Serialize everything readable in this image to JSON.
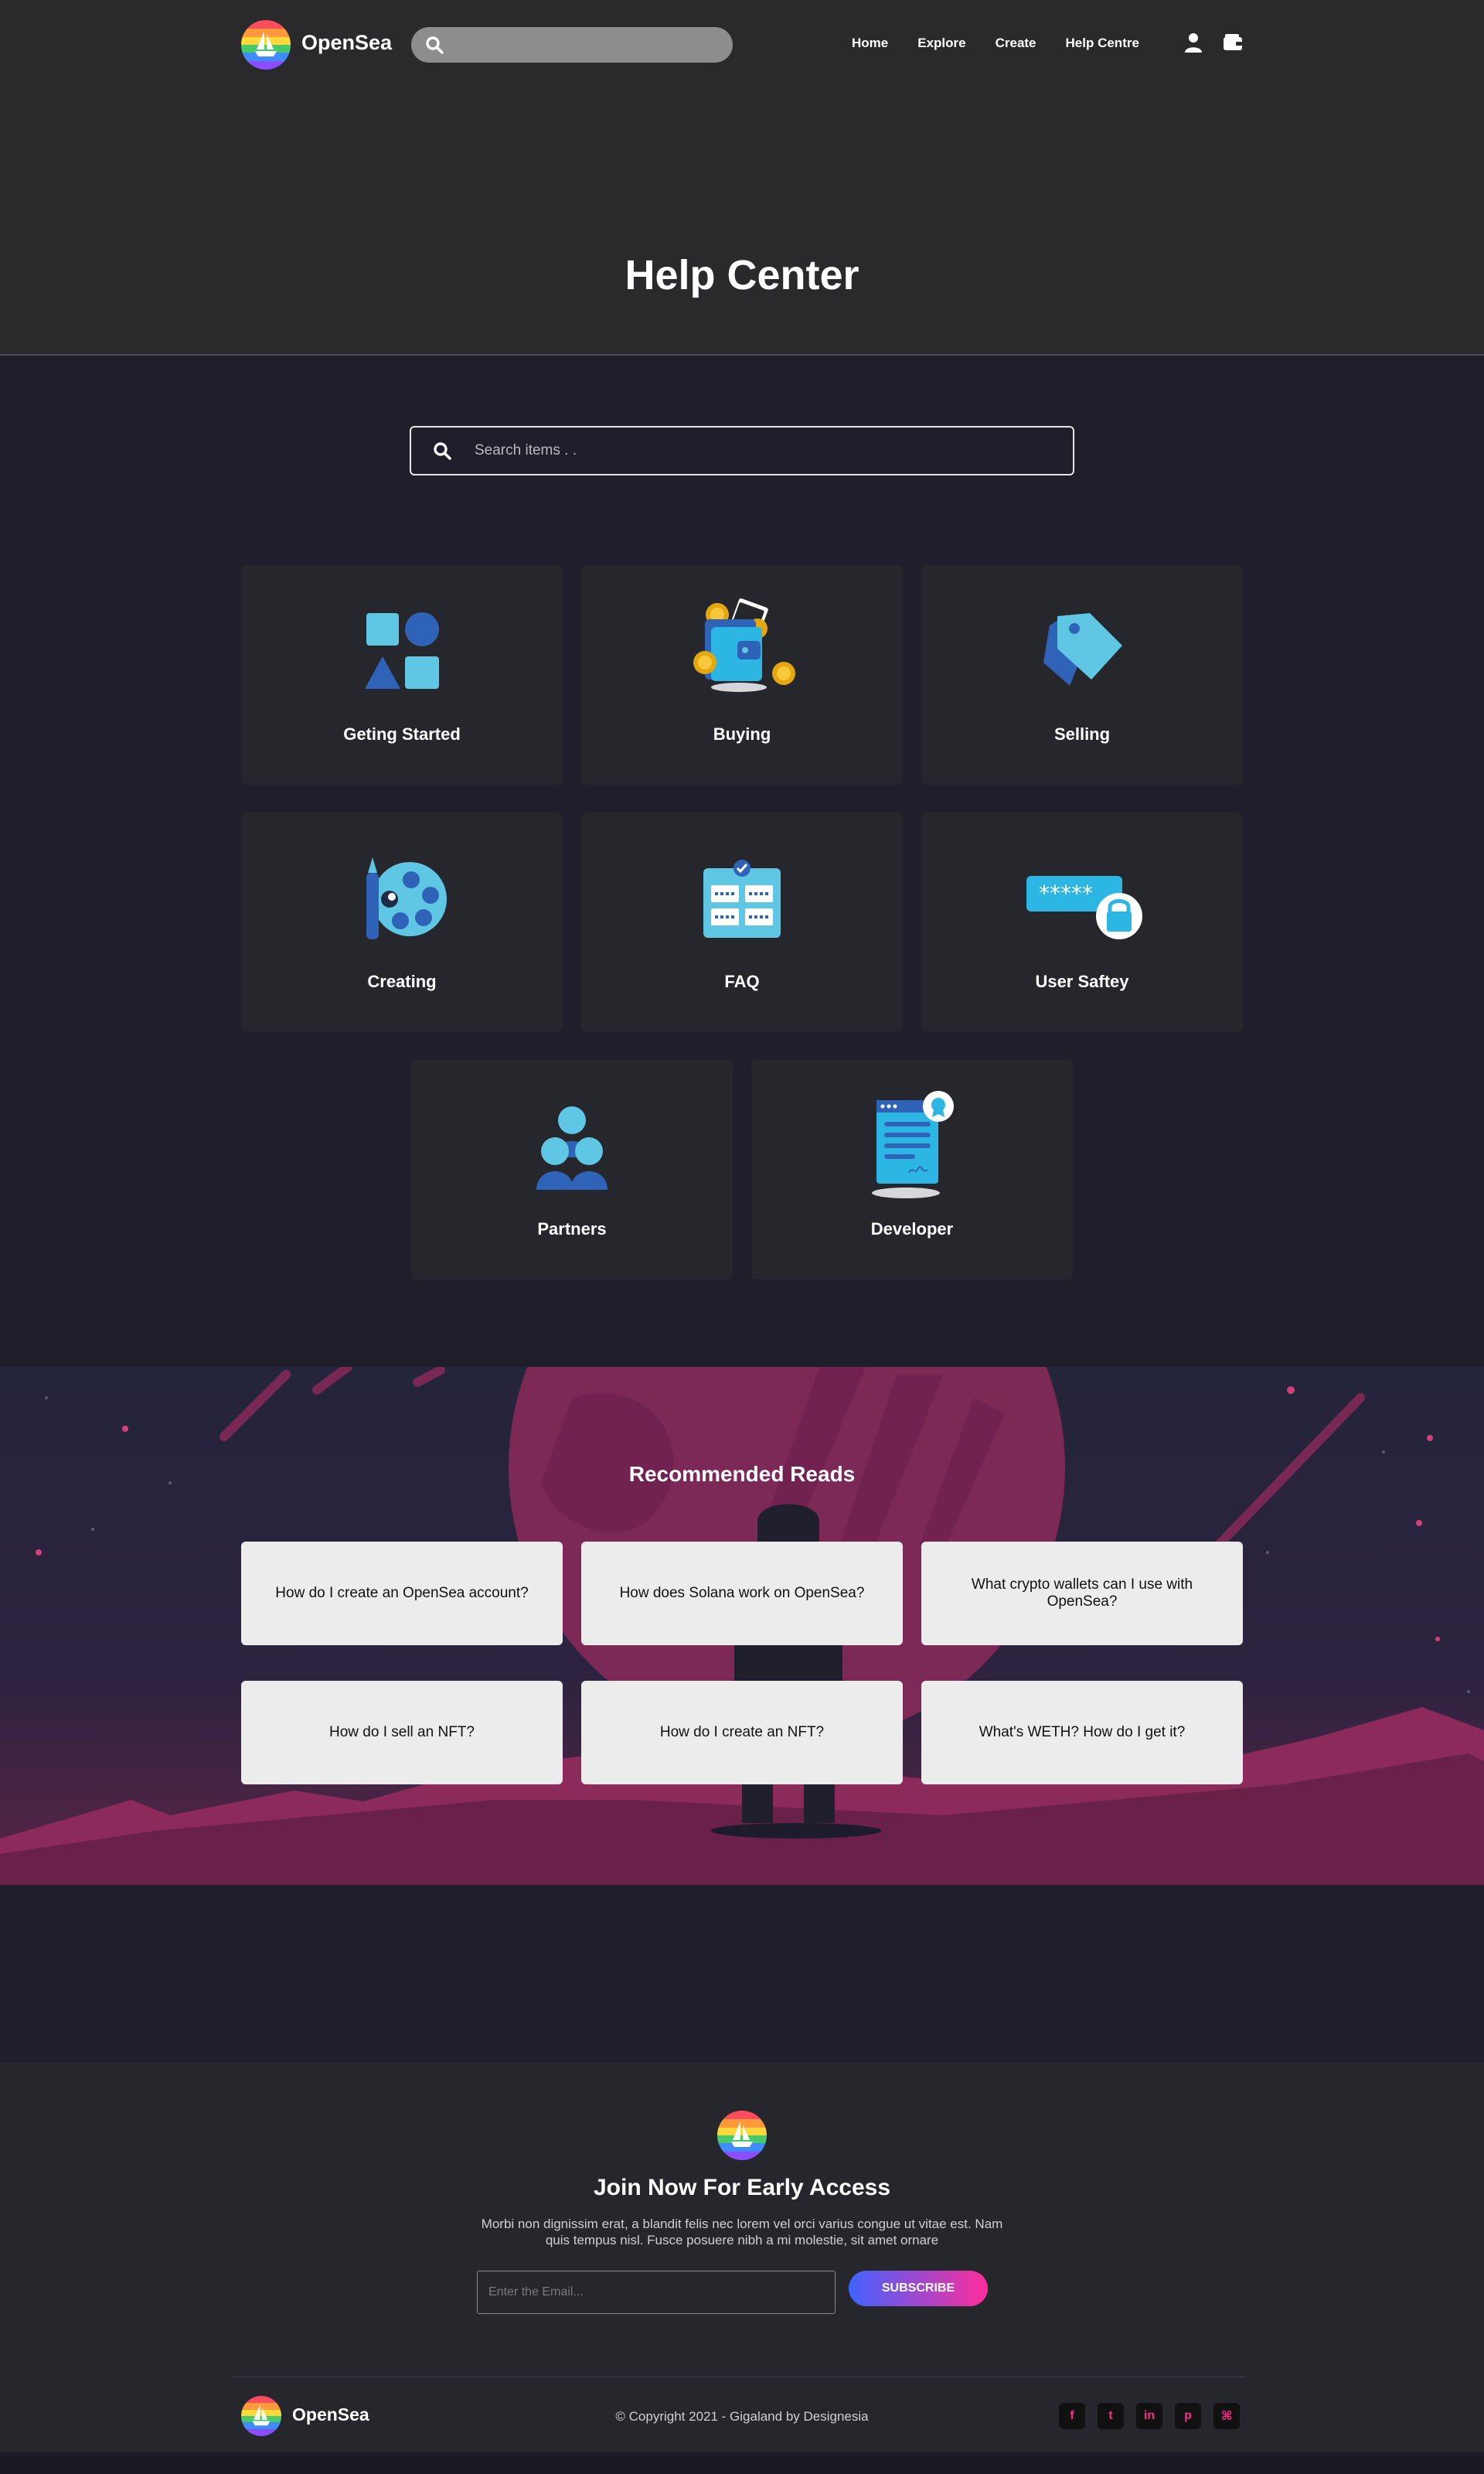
{
  "header": {
    "brand": "OpenSea",
    "nav": [
      {
        "label": "Home"
      },
      {
        "label": "Explore"
      },
      {
        "label": "Create"
      },
      {
        "label": "Help Centre"
      }
    ],
    "icons": [
      "search-icon",
      "user-icon",
      "wallet-icon"
    ],
    "title": "Help Center"
  },
  "search": {
    "placeholder": "Search items . ."
  },
  "categories": [
    {
      "label": "Geting Started",
      "icon": "shapes-icon"
    },
    {
      "label": "Buying",
      "icon": "wallet-coins-icon"
    },
    {
      "label": "Selling",
      "icon": "price-tag-icon"
    },
    {
      "label": "Creating",
      "icon": "palette-brush-icon"
    },
    {
      "label": "FAQ",
      "icon": "faq-board-icon"
    },
    {
      "label": "User Saftey",
      "icon": "password-lock-icon"
    },
    {
      "label": "Partners",
      "icon": "people-group-icon"
    },
    {
      "label": "Developer",
      "icon": "document-badge-icon"
    }
  ],
  "recommended": {
    "title": "Recommended Reads",
    "items": [
      "How do I create an OpenSea account?",
      "How does Solana work on OpenSea?",
      "What crypto wallets can I use with OpenSea?",
      "How do I sell an NFT?",
      "How do I create an NFT?",
      "What's WETH? How do I get it?"
    ]
  },
  "footer": {
    "join_title": "Join Now For Early Access",
    "join_text": "Morbi non dignissim erat, a blandit felis nec lorem vel orci varius congue ut vitae est. Nam quis tempus nisl. Fusce posuere nibh a mi molestie, sit amet ornare",
    "email_placeholder": "Enter the Email...",
    "subscribe_label": "SUBSCRIBE",
    "brand": "OpenSea",
    "copyright": "© Copyright 2021 - Gigaland by Designesia",
    "social": [
      {
        "icon": "facebook-icon",
        "glyph": "f"
      },
      {
        "icon": "twitter-icon",
        "glyph": "t"
      },
      {
        "icon": "linkedin-icon",
        "glyph": "in"
      },
      {
        "icon": "pinterest-icon",
        "glyph": "p"
      },
      {
        "icon": "rss-icon",
        "glyph": "⌘"
      }
    ]
  },
  "colors": {
    "header_bg": "#2a2a2c",
    "page_bg": "#1e1f2b",
    "card_bg": "#26272c",
    "accent_pink": "#ff2d9b",
    "accent_blue": "#3f63ff",
    "icon_light_blue": "#5fc6e4",
    "icon_dark_blue": "#2f63b8"
  }
}
